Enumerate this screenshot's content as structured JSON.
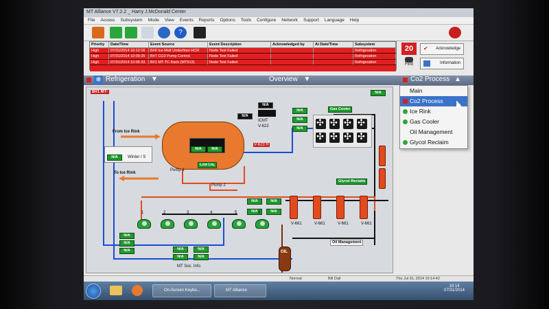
{
  "window": {
    "title": "MT Alliance V7.2.2 _ Harry J.McDonald Center"
  },
  "menu": [
    "File",
    "Access",
    "Subsystem",
    "Mode",
    "View",
    "Events",
    "Reports",
    "Options",
    "Tools",
    "Configure",
    "Network",
    "Support",
    "Language",
    "Help"
  ],
  "alarm_table": {
    "headers": [
      "Priority",
      "Date/Time",
      "Event Source",
      "Event Description",
      "Acknowledged by",
      "At Date/Time",
      "Subsystem"
    ],
    "rows": [
      [
        "High",
        "07/31/2014 10:12:16",
        "B#6 Ice Melt Underfloor HCR",
        "Node Test Failed",
        "",
        "",
        "Refrigeration"
      ],
      [
        "High",
        "07/31/2014 10:09:25",
        "B#7 CO2 Pump Control",
        "Node Test Failed",
        "",
        "",
        "Refrigeration"
      ],
      [
        "High",
        "07/31/2014 10:06:33",
        "B#1 MT-TC Rack (MT512)",
        "Node Test Failed",
        "",
        "",
        "Refrigeration"
      ]
    ]
  },
  "alarm_count": "20",
  "find_label": "Find",
  "acknowledge_label": "Acknowledge",
  "information_label": "Information",
  "nav": {
    "left": "Refrigeration",
    "center": "Overview",
    "right": "Co2 Process"
  },
  "dropdown": {
    "items": [
      {
        "label": "Main",
        "dot": ""
      },
      {
        "label": "Co2 Process",
        "dot": "#d42020"
      },
      {
        "label": "Ice Rink",
        "dot": "#2aa63a"
      },
      {
        "label": "Gas Cooler",
        "dot": "#2aa63a"
      },
      {
        "label": "Oil Management",
        "dot": ""
      },
      {
        "label": "Glycol Reclaim",
        "dot": "#2aa63a"
      }
    ],
    "selected_index": 1
  },
  "diagram": {
    "node_label": "B#1 MT-",
    "na": "N/A",
    "from_ice_rink": "From Ice Rink",
    "to_ice_rink": "To Ice Rink",
    "winter": "Winter / S",
    "pump1": "Pump 1",
    "pump2": "Pump 2",
    "low_liq": "Low Liq.",
    "gas_cooler": "Gas Cooler",
    "glycol_reclaim": "Glycol Reclaim",
    "oil_management": "Oil Management",
    "oil": "OIL",
    "mt_soc_info": "MT Soc. Info",
    "v623": "V-623 R",
    "icmt": "ICMT",
    "v622": "V-622",
    "compressor_numbers": [
      "1",
      "2",
      "3",
      "4",
      "5",
      "6"
    ],
    "valve_labels": [
      "V-661",
      "V-661",
      "V-661",
      "V-661"
    ]
  },
  "statusbar": {
    "mode": "Normal",
    "user": "Bill Dail",
    "datetime": "Thu Jul 31, 2014 10:14:42"
  },
  "taskbar": {
    "tasks": [
      "On-Screen Keybo...",
      "MT Alliance"
    ],
    "clock_time": "10:14",
    "clock_date": "07/31/2014"
  },
  "colors": {
    "alarm": "#e02020",
    "ok": "#1f9a2d",
    "vessel": "#e8792e",
    "pipe_blue": "#1a4ad6",
    "pipe_orange": "#e8792e"
  }
}
